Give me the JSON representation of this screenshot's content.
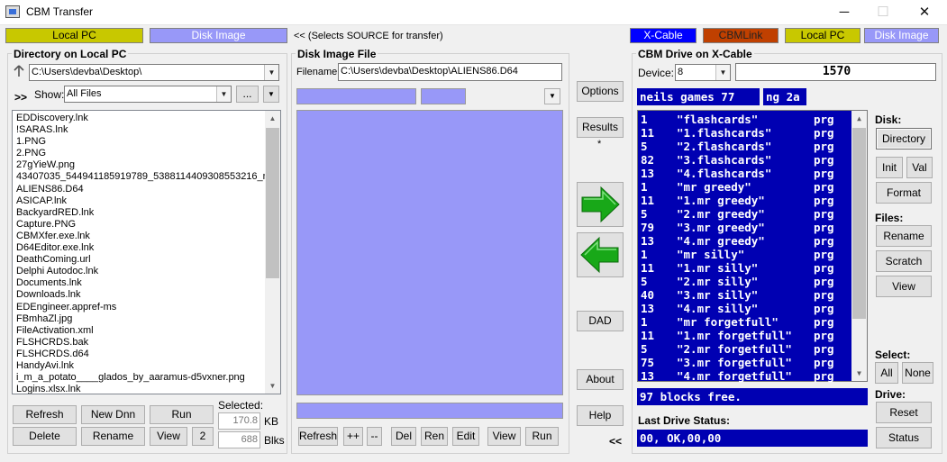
{
  "window": {
    "title": "CBM Transfer",
    "min_icon": "minimize-icon",
    "max_icon": "maximize-icon",
    "close_icon": "close-icon"
  },
  "source_bar": {
    "local_pc": "Local PC",
    "disk_image": "Disk Image",
    "hint": "<< (Selects SOURCE for transfer)",
    "xcable": "X-Cable",
    "cbmlink": "CBMLink",
    "local_pc_right": "Local PC",
    "disk_image_right": "Disk Image",
    "colors": {
      "local_pc": "#c8c800",
      "disk_image": "#9898f8",
      "xcable": "#0000ff",
      "cbmlink": "#c04000"
    }
  },
  "local_pc": {
    "title": "Directory on Local PC",
    "path": "C:\\Users\\devba\\Desktop\\",
    "nav_symbol": ">>",
    "show_label": "Show:",
    "show_value": "All Files",
    "browse_label": "...",
    "files": [
      "EDDiscovery.lnk",
      "!SARAS.lnk",
      "1.PNG",
      "2.PNG",
      "27gYieW.png",
      "43407035_544941185919789_5388114409308553216_n",
      "ALIENS86.D64",
      "ASICAP.lnk",
      "BackyardRED.lnk",
      "Capture.PNG",
      "CBMXfer.exe.lnk",
      "D64Editor.exe.lnk",
      "DeathComing.url",
      "Delphi Autodoc.lnk",
      "Documents.lnk",
      "Downloads.lnk",
      "EDEngineer.appref-ms",
      "FBmhaZl.jpg",
      "FileActivation.xml",
      "FLSHCRDS.bak",
      "FLSHCRDS.d64",
      "HandyAvi.lnk",
      "i_m_a_potato____glados_by_aaramus-d5vxner.png",
      "Logins.xlsx.lnk"
    ],
    "selected_label": "Selected:",
    "kb_value": "170.8",
    "kb_unit": "KB",
    "blks_value": "688",
    "blks_unit": "Blks",
    "buttons": {
      "refresh": "Refresh",
      "new_dnn": "New Dnn",
      "run": "Run",
      "delete": "Delete",
      "rename": "Rename",
      "view": "View",
      "two": "2"
    }
  },
  "disk_image": {
    "title": "Disk Image File",
    "filename_label": "Filename:",
    "filename": "C:\\Users\\devba\\Desktop\\ALIENS86.D64",
    "buttons": {
      "refresh": "Refresh",
      "plusplus": "++",
      "minusminus": "--",
      "del": "Del",
      "ren": "Ren",
      "edit": "Edit",
      "view": "View",
      "run": "Run"
    }
  },
  "middle": {
    "options": "Options",
    "results": "Results",
    "results_mark": "*",
    "dad": "DAD",
    "about": "About",
    "help": "Help",
    "back_symbol": "<<"
  },
  "drive": {
    "title": "CBM Drive on X-Cable",
    "device_label": "Device:",
    "device_value": "8",
    "drive_model": "1570",
    "disk_name": "neils games 77",
    "disk_id": "ng 2a",
    "entries": [
      {
        "blocks": "1",
        "name": "\"flashcards\"",
        "type": "prg"
      },
      {
        "blocks": "11",
        "name": "\"1.flashcards\"",
        "type": "prg"
      },
      {
        "blocks": "5",
        "name": "\"2.flashcards\"",
        "type": "prg"
      },
      {
        "blocks": "82",
        "name": "\"3.flashcards\"",
        "type": "prg"
      },
      {
        "blocks": "13",
        "name": "\"4.flashcards\"",
        "type": "prg"
      },
      {
        "blocks": "1",
        "name": "\"mr greedy\"",
        "type": "prg"
      },
      {
        "blocks": "11",
        "name": "\"1.mr greedy\"",
        "type": "prg"
      },
      {
        "blocks": "5",
        "name": "\"2.mr greedy\"",
        "type": "prg"
      },
      {
        "blocks": "79",
        "name": "\"3.mr greedy\"",
        "type": "prg"
      },
      {
        "blocks": "13",
        "name": "\"4.mr greedy\"",
        "type": "prg"
      },
      {
        "blocks": "1",
        "name": "\"mr silly\"",
        "type": "prg"
      },
      {
        "blocks": "11",
        "name": "\"1.mr silly\"",
        "type": "prg"
      },
      {
        "blocks": "5",
        "name": "\"2.mr silly\"",
        "type": "prg"
      },
      {
        "blocks": "40",
        "name": "\"3.mr silly\"",
        "type": "prg"
      },
      {
        "blocks": "13",
        "name": "\"4.mr silly\"",
        "type": "prg"
      },
      {
        "blocks": "1",
        "name": "\"mr forgetfull\"",
        "type": "prg"
      },
      {
        "blocks": "11",
        "name": "\"1.mr forgetfull\"",
        "type": "prg"
      },
      {
        "blocks": "5",
        "name": "\"2.mr forgetfull\"",
        "type": "prg"
      },
      {
        "blocks": "75",
        "name": "\"3.mr forgetfull\"",
        "type": "prg"
      },
      {
        "blocks": "13",
        "name": "\"4.mr forgetfull\"",
        "type": "prg"
      }
    ],
    "blocks_free": "97 blocks free.",
    "last_status_label": "Last Drive Status:",
    "last_status": "00, OK,00,00",
    "disk_label": "Disk:",
    "directory": "Directory",
    "init": "Init",
    "val": "Val",
    "format": "Format",
    "files_label": "Files:",
    "rename": "Rename",
    "scratch": "Scratch",
    "view": "View",
    "select_label": "Select:",
    "all": "All",
    "none": "None",
    "drive_label": "Drive:",
    "reset": "Reset",
    "status": "Status"
  },
  "icons": [
    "app-icon",
    "up-arrow-icon",
    "chevron-down-icon",
    "right-arrow-icon",
    "left-arrow-icon"
  ]
}
